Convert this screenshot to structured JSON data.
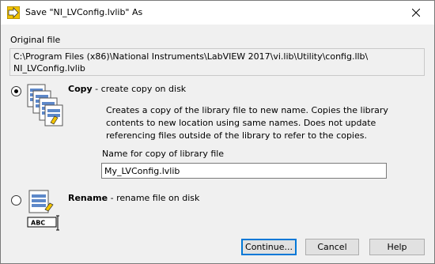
{
  "window": {
    "title": "Save \"NI_LVConfig.lvlib\" As",
    "icons": {
      "app": "labview-app-icon",
      "close": "close-icon"
    }
  },
  "original_file": {
    "label": "Original file",
    "path": "C:\\Program Files (x86)\\National Instruments\\LabVIEW 2017\\vi.lib\\Utility\\config.llb\\\nNI_LVConfig.lvlib"
  },
  "options": {
    "copy": {
      "title": "Copy",
      "subtitle": " - create copy on disk",
      "selected": true,
      "description": "Creates a copy of the library file to new name. Copies the library contents to new location using same names. Does not update referencing files outside of the library to refer to the copies.",
      "name_label": "Name for copy of library file",
      "name_value": "My_LVConfig.lvlib"
    },
    "rename": {
      "title": "Rename",
      "subtitle": " - rename file on disk",
      "selected": false,
      "icon_text": "ABC"
    }
  },
  "buttons": {
    "continue": "Continue...",
    "cancel": "Cancel",
    "help": "Help"
  },
  "colors": {
    "accent": "#0078d7",
    "background": "#f0f0f0"
  }
}
